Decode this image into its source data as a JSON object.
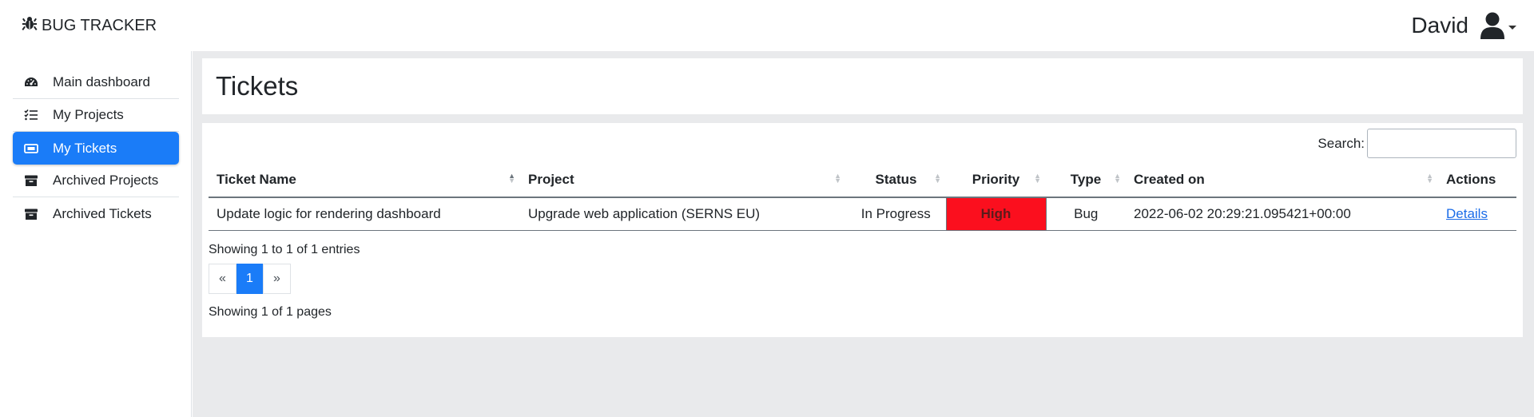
{
  "brand": {
    "name": "BUG TRACKER"
  },
  "user": {
    "name": "David"
  },
  "sidebar": {
    "items": [
      {
        "label": "Main dashboard",
        "icon": "dashboard-icon"
      },
      {
        "label": "My Projects",
        "icon": "list-icon"
      },
      {
        "label": "My Tickets",
        "icon": "ticket-icon",
        "active": true
      },
      {
        "label": "Archived Projects",
        "icon": "archive-icon"
      },
      {
        "label": "Archived Tickets",
        "icon": "archive-icon"
      }
    ]
  },
  "page": {
    "title": "Tickets"
  },
  "search": {
    "label": "Search:",
    "value": ""
  },
  "table": {
    "columns": [
      "Ticket Name",
      "Project",
      "Status",
      "Priority",
      "Type",
      "Created on",
      "Actions"
    ],
    "rows": [
      {
        "ticket_name": "Update logic for rendering dashboard",
        "project": "Upgrade web application (SERNS EU)",
        "status": "In Progress",
        "priority": "High",
        "type": "Bug",
        "created_on": "2022-06-02 20:29:21.095421+00:00",
        "action": "Details"
      }
    ]
  },
  "footer": {
    "entries_info": "Showing 1 to 1 of 1 entries",
    "pages_info": "Showing 1 of 1 pages"
  },
  "pagination": {
    "prev": "«",
    "current": "1",
    "next": "»"
  },
  "colors": {
    "accent": "#1a7cf8",
    "priority_high": "#fb0f1e",
    "link": "#1a6ce8"
  }
}
